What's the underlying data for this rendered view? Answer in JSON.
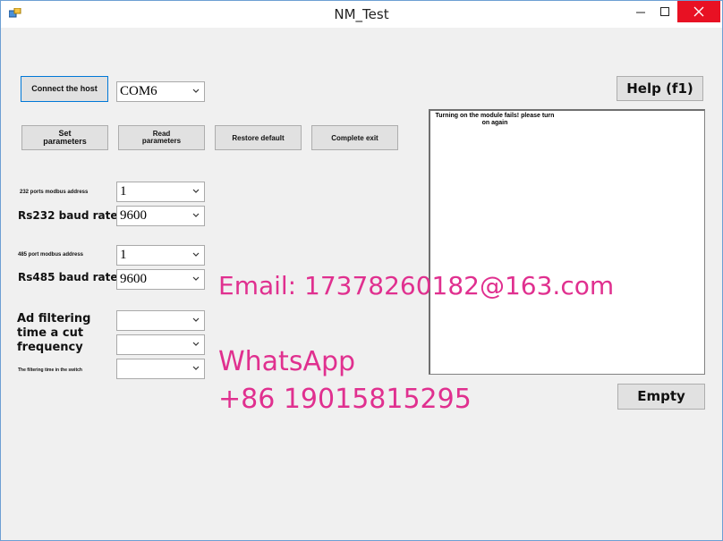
{
  "window": {
    "title": "NM_Test"
  },
  "buttons": {
    "connect": "Connect the host",
    "set": [
      "Set",
      "parameters"
    ],
    "read": [
      "Read",
      "parameters"
    ],
    "restore": "Restore default",
    "exit": "Complete exit",
    "help": "Help (f1)",
    "empty": "Empty"
  },
  "port": {
    "value": "COM6"
  },
  "rs232": {
    "address_label": "232 ports modbus address",
    "address_value": "1",
    "baud_label": "Rs232 baud rate",
    "baud_value": "9600"
  },
  "rs485": {
    "address_label": "485 port modbus address",
    "address_value": "1",
    "baud_label": "Rs485 baud rate",
    "baud_value": "9600"
  },
  "filter": {
    "label_lines": [
      "Ad filtering",
      "time a cut",
      "frequency"
    ],
    "switch_label": "The filtering time in the switch"
  },
  "output": {
    "text": "Turning on the module fails! please turn on again"
  },
  "watermark": {
    "email": "Email: 17378260182@163.com",
    "whatsapp": "WhatsApp",
    "phone": "+86 19015815295"
  },
  "colors": {
    "watermark": "#e0308f",
    "close": "#e81123",
    "focus_border": "#0078d7"
  },
  "icons": {
    "app": "app-icon",
    "minimize": "minimize-icon",
    "maximize": "maximize-icon",
    "close": "close-icon",
    "dropdown": "chevron-down-icon"
  }
}
